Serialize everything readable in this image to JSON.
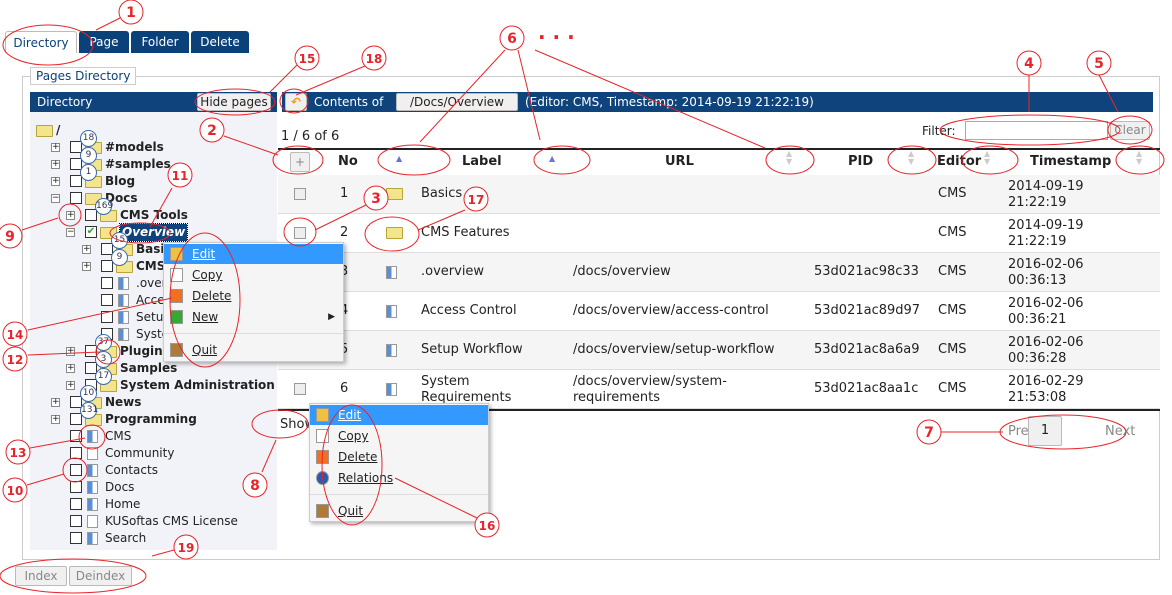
{
  "tabs": [
    {
      "label": "Directory",
      "active": true
    },
    {
      "label": "Page"
    },
    {
      "label": "Folder"
    },
    {
      "label": "Delete"
    }
  ],
  "legend": "Pages Directory",
  "left_header": {
    "title": "Directory",
    "hide_pages": "Hide pages"
  },
  "right_header": {
    "contents_of": "Contents of",
    "path": "/Docs/Overview",
    "info": "(Editor: CMS, Timestamp: 2014-09-19 21:22:19)"
  },
  "tree": [
    {
      "level": 0,
      "type": "folder",
      "label": "/",
      "bold": true
    },
    {
      "level": 1,
      "type": "folder",
      "label": "#models",
      "badge": "18",
      "exp": "+",
      "bold": true
    },
    {
      "level": 1,
      "type": "folder",
      "label": "#samples",
      "badge": "9",
      "exp": "+",
      "bold": true
    },
    {
      "level": 1,
      "type": "folder",
      "label": "Blog",
      "badge": "1",
      "exp": "+",
      "bold": true
    },
    {
      "level": 1,
      "type": "folder",
      "label": "Docs",
      "exp": "-",
      "bold": true
    },
    {
      "level": 2,
      "type": "folder",
      "label": "CMS Tools",
      "badge": "169",
      "exp": "+",
      "bold": true
    },
    {
      "level": 2,
      "type": "folder",
      "label": "Overview",
      "exp": "-",
      "bold": true,
      "checked": true,
      "selected": true
    },
    {
      "level": 3,
      "type": "folder",
      "label": "Basics",
      "badge": "15",
      "exp": "+",
      "bold": true
    },
    {
      "level": 3,
      "type": "folder",
      "label": "CMS Features",
      "badge": "9",
      "exp": "+",
      "bold": true
    },
    {
      "level": 3,
      "type": "mpage",
      "label": ".overview"
    },
    {
      "level": 3,
      "type": "mpage",
      "label": "Access Control"
    },
    {
      "level": 3,
      "type": "mpage",
      "label": "Setup Workflow"
    },
    {
      "level": 3,
      "type": "mpage",
      "label": "System Requirements"
    },
    {
      "level": 2,
      "type": "folder",
      "label": "Plugins",
      "badge": "37",
      "exp": "+",
      "bold": true
    },
    {
      "level": 2,
      "type": "folder",
      "label": "Samples",
      "badge": "3",
      "exp": "+",
      "bold": true
    },
    {
      "level": 2,
      "type": "folder",
      "label": "System Administration",
      "badge": "17",
      "exp": "+",
      "bold": true
    },
    {
      "level": 1,
      "type": "folder",
      "label": "News",
      "badge": "10",
      "exp": "+",
      "bold": true
    },
    {
      "level": 1,
      "type": "folder",
      "label": "Programming",
      "badge": "131",
      "exp": "+",
      "bold": true
    },
    {
      "level": 1,
      "type": "mpage",
      "label": "CMS"
    },
    {
      "level": 1,
      "type": "page",
      "label": "Community"
    },
    {
      "level": 1,
      "type": "mpage",
      "label": "Contacts"
    },
    {
      "level": 1,
      "type": "mpage",
      "label": "Docs"
    },
    {
      "level": 1,
      "type": "mpage",
      "label": "Home"
    },
    {
      "level": 1,
      "type": "page",
      "label": "KUSoftas CMS License"
    },
    {
      "level": 1,
      "type": "mpage",
      "label": "Search"
    }
  ],
  "listing": {
    "count": "1 / 6 of 6",
    "filter_label": "Filter:",
    "filter_value": "",
    "clear": "Clear",
    "add": "+",
    "columns": [
      "No",
      "Label",
      "URL",
      "PID",
      "Editor",
      "Timestamp"
    ],
    "rows": [
      {
        "no": "1",
        "type": "folder",
        "label": "Basics",
        "url": "",
        "pid": "",
        "editor": "CMS",
        "ts": [
          "2014-09-19",
          "21:22:19"
        ]
      },
      {
        "no": "2",
        "type": "folder",
        "label": "CMS Features",
        "url": "",
        "pid": "",
        "editor": "CMS",
        "ts": [
          "2014-09-19",
          "21:22:19"
        ]
      },
      {
        "no": "3",
        "type": "mpage",
        "label": ".overview",
        "url": "/docs/overview",
        "pid": "53d021ac98c33",
        "editor": "CMS",
        "ts": [
          "2016-02-06",
          "00:36:13"
        ]
      },
      {
        "no": "4",
        "type": "mpage",
        "label": "Access Control",
        "url": "/docs/overview/access-control",
        "pid": "53d021ac89d97",
        "editor": "CMS",
        "ts": [
          "2016-02-06",
          "00:36:21"
        ]
      },
      {
        "no": "5",
        "type": "mpage",
        "label": "Setup Workflow",
        "url": "/docs/overview/setup-workflow",
        "pid": "53d021ac8a6a9",
        "editor": "CMS",
        "ts": [
          "2016-02-06",
          "00:36:28"
        ]
      },
      {
        "no": "6",
        "type": "mpage",
        "label": "System Requirements",
        "url": "/docs/overview/system-requirements",
        "pid": "53d021ac8aa1c",
        "editor": "CMS",
        "ts": [
          "2016-02-29",
          "21:53:08"
        ]
      }
    ],
    "show": "Show",
    "prev": "Prev",
    "page": "1",
    "next": "Next"
  },
  "menu1": [
    {
      "label": "Edit",
      "icon": "pencil-icon",
      "hl": true
    },
    {
      "label": "Copy",
      "icon": "copy-icon"
    },
    {
      "label": "Delete",
      "icon": "delete-icon"
    },
    {
      "label": "New",
      "icon": "plus-icon",
      "sub": true
    },
    {
      "label": "Quit",
      "icon": "door-icon"
    }
  ],
  "menu2": [
    {
      "label": "Edit",
      "icon": "pencil-icon",
      "hl": true
    },
    {
      "label": "Copy",
      "icon": "copy-icon"
    },
    {
      "label": "Delete",
      "icon": "delete-icon"
    },
    {
      "label": "Relations",
      "icon": "globe-icon"
    },
    {
      "label": "Quit",
      "icon": "door-icon"
    }
  ],
  "bottom": {
    "index": "Index",
    "deindex": "Deindex"
  },
  "annotations": [
    "1",
    "2",
    "3",
    "4",
    "5",
    "6",
    "7",
    "8",
    "9",
    "10",
    "11",
    "12",
    "13",
    "14",
    "15",
    "16",
    "17",
    "18",
    "19"
  ],
  "annotation_dots": "· · ·",
  "colors": {
    "header": "#0e437b",
    "annotation": "#e8242a",
    "highlight": "#3399ff"
  }
}
